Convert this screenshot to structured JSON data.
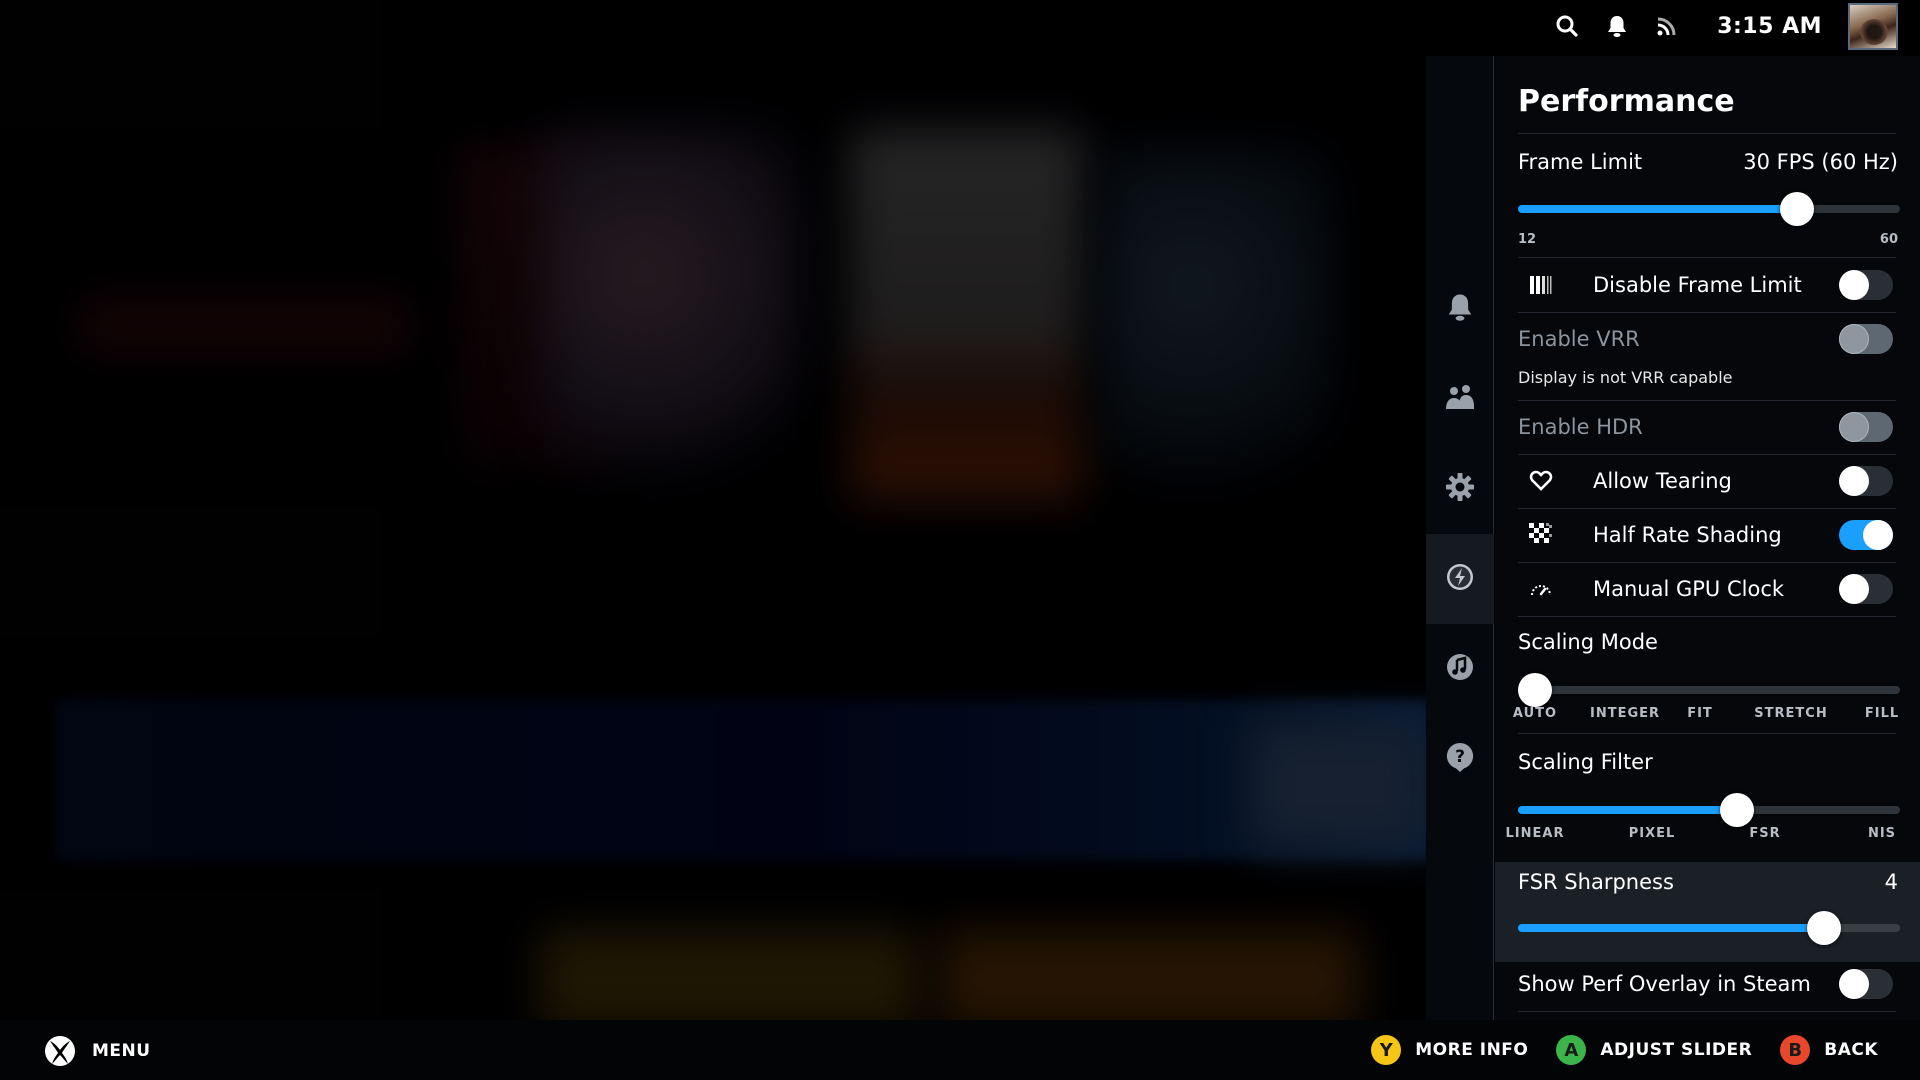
{
  "topbar": {
    "clock": "3:15 AM",
    "icons": [
      "search-icon",
      "bell-icon",
      "rss-icon"
    ],
    "avatar": "user-avatar"
  },
  "qam_sidebar": {
    "tabs": [
      {
        "name": "notifications",
        "icon": "bell-icon",
        "active": false
      },
      {
        "name": "friends",
        "icon": "friends-icon",
        "active": false
      },
      {
        "name": "settings",
        "icon": "gear-icon",
        "active": false
      },
      {
        "name": "performance",
        "icon": "lightning-icon",
        "active": true
      },
      {
        "name": "music",
        "icon": "music-icon",
        "active": false
      },
      {
        "name": "help",
        "icon": "help-icon",
        "active": false
      }
    ]
  },
  "panel": {
    "title": "Performance",
    "frame_limit": {
      "label": "Frame Limit",
      "value": "30 FPS (60 Hz)",
      "min_label": "12",
      "max_label": "60",
      "fraction": 0.73
    },
    "toggles": {
      "disable_frame_limit": {
        "label": "Disable Frame Limit",
        "on": false,
        "icon": "frame-limit-icon"
      },
      "enable_vrr": {
        "label": "Enable VRR",
        "on": false,
        "disabled": true,
        "note": "Display is not VRR capable"
      },
      "enable_hdr": {
        "label": "Enable HDR",
        "on": false,
        "disabled": true
      },
      "allow_tearing": {
        "label": "Allow Tearing",
        "on": false,
        "icon": "tearing-heart-icon"
      },
      "half_rate_shading": {
        "label": "Half Rate Shading",
        "on": true,
        "icon": "checkerboard-icon"
      },
      "manual_gpu_clock": {
        "label": "Manual GPU Clock",
        "on": false,
        "icon": "gauge-icon"
      },
      "show_perf_overlay": {
        "label": "Show Perf Overlay in Steam",
        "on": false
      }
    },
    "scaling_mode": {
      "label": "Scaling Mode",
      "options": [
        "AUTO",
        "INTEGER",
        "FIT",
        "STRETCH",
        "FILL"
      ],
      "selected_index": 0
    },
    "scaling_filter": {
      "label": "Scaling Filter",
      "options": [
        "LINEAR",
        "PIXEL",
        "FSR",
        "NIS"
      ],
      "selected_index": 2
    },
    "fsr_sharpness": {
      "label": "FSR Sharpness",
      "value": "4",
      "fraction": 0.8
    }
  },
  "footer": {
    "menu_label": "MENU",
    "hints": [
      {
        "button": "Y",
        "label": "MORE INFO",
        "color": "#f5c518"
      },
      {
        "button": "A",
        "label": "ADJUST SLIDER",
        "color": "#3bb54a"
      },
      {
        "button": "B",
        "label": "BACK",
        "color": "#e8472b"
      }
    ]
  },
  "colors": {
    "accent": "#1a9fff",
    "panel_bg": "#05070b",
    "focus_bg": "#1b1f26"
  }
}
